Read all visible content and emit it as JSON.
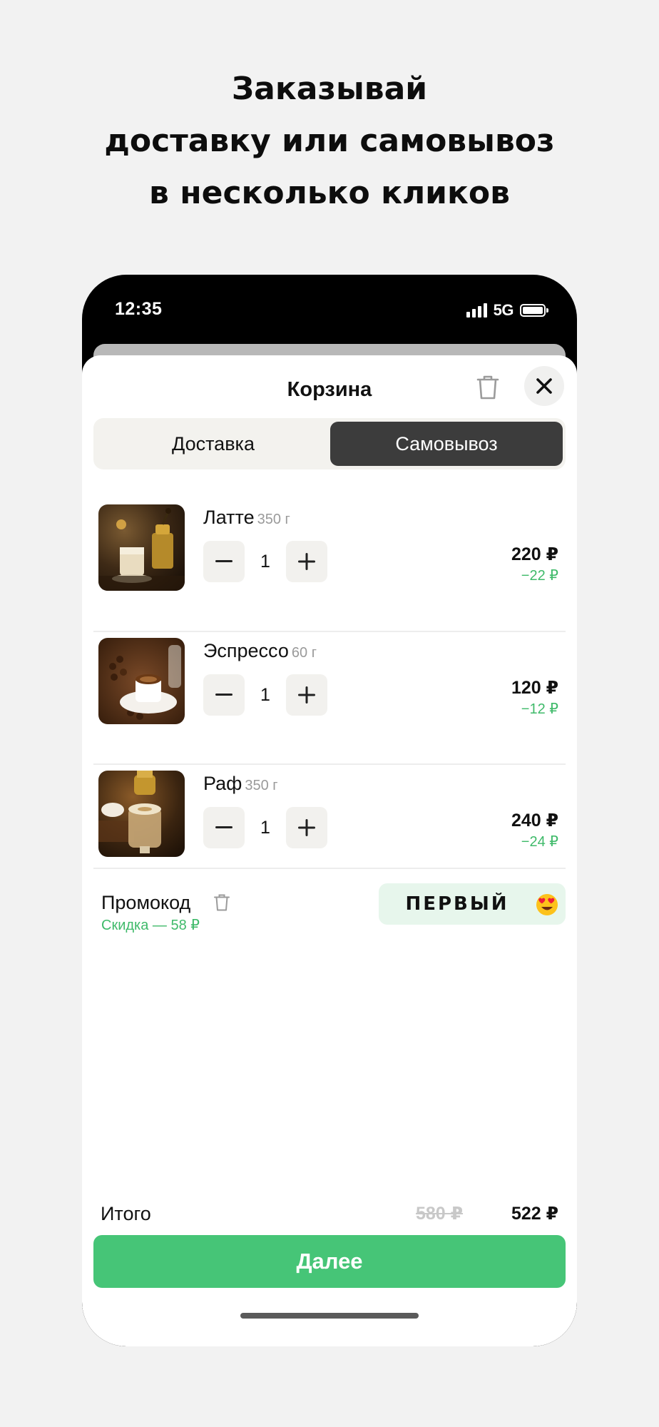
{
  "headline": {
    "line1": "Заказывай",
    "line2": "доставку или самовывоз",
    "line3": "в несколько кликов"
  },
  "status_bar": {
    "time": "12:35",
    "network": "5G"
  },
  "cart": {
    "title": "Корзина",
    "tabs": [
      {
        "label": "Доставка",
        "active": false
      },
      {
        "label": "Самовывоз",
        "active": true
      }
    ],
    "items": [
      {
        "name": "Латте",
        "weight": "350 г",
        "quantity": "1",
        "price": "220 ₽",
        "discount": "−22 ₽"
      },
      {
        "name": "Эспрессо",
        "weight": "60 г",
        "quantity": "1",
        "price": "120 ₽",
        "discount": "−12 ₽"
      },
      {
        "name": "Раф",
        "weight": "350 г",
        "quantity": "1",
        "price": "240 ₽",
        "discount": "−24 ₽"
      }
    ],
    "promo": {
      "label": "Промокод",
      "discount_text": "Скидка — 58 ₽",
      "code": "ПЕРВЫЙ"
    },
    "total": {
      "label": "Итого",
      "old_price": "580 ₽",
      "new_price": "522 ₽"
    },
    "next_button": "Далее"
  },
  "colors": {
    "accent_green": "#46c577",
    "discount_green": "#3fba6a",
    "active_tab": "#3c3c3c",
    "background": "#f2f2f2"
  },
  "icons": [
    "trash-icon",
    "close-icon",
    "minus-icon",
    "plus-icon",
    "heart-eyes-emoji-icon",
    "signal-icon",
    "battery-icon"
  ]
}
